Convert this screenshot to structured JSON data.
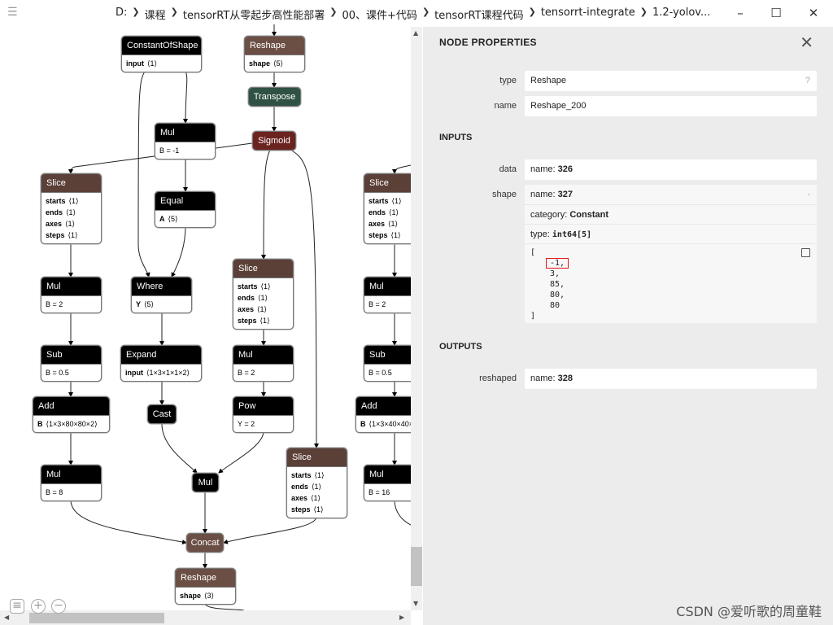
{
  "titlebar": {
    "menu_icon": "hamburger-icon",
    "breadcrumb": [
      "D:",
      "课程",
      "tensorRT从零起步高性能部署",
      "00、课件+代码",
      "tensorRT课程代码",
      "tensorrt-integrate",
      "1.2-yolov..."
    ],
    "minimize": "–",
    "maximize": "☐",
    "close": "✕"
  },
  "colors": {
    "layer": "#000000",
    "shape": "#6b4e44",
    "transform": "#2f5244",
    "activation": "#6b2320",
    "slice": "#5b4038"
  },
  "graph": {
    "nodes": [
      {
        "op": "ConstantOfShape",
        "kind": "layer",
        "attrs": [
          {
            "b": "input",
            "v": "⟨1⟩"
          }
        ]
      },
      {
        "op": "Reshape",
        "kind": "shape",
        "attrs": [
          {
            "b": "shape",
            "v": "⟨5⟩"
          }
        ]
      },
      {
        "op": "Transpose",
        "kind": "transform",
        "attrs": []
      },
      {
        "op": "Mul",
        "kind": "layer",
        "attrs": [
          {
            "b": "",
            "v": "B = -1"
          }
        ]
      },
      {
        "op": "Sigmoid",
        "kind": "activation",
        "attrs": []
      },
      {
        "op": "Slice",
        "kind": "slice",
        "attrs": [
          {
            "b": "starts",
            "v": "⟨1⟩"
          },
          {
            "b": "ends",
            "v": "⟨1⟩"
          },
          {
            "b": "axes",
            "v": "⟨1⟩"
          },
          {
            "b": "steps",
            "v": "⟨1⟩"
          }
        ]
      },
      {
        "op": "Equal",
        "kind": "layer",
        "attrs": [
          {
            "b": "A",
            "v": "⟨5⟩"
          }
        ]
      },
      {
        "op": "Slice",
        "kind": "slice",
        "attrs": [
          {
            "b": "starts",
            "v": "⟨1⟩"
          },
          {
            "b": "ends",
            "v": "⟨1⟩"
          },
          {
            "b": "axes",
            "v": "⟨1⟩"
          },
          {
            "b": "steps",
            "v": "⟨1⟩"
          }
        ]
      },
      {
        "op": "Slice",
        "kind": "slice",
        "attrs": [
          {
            "b": "starts",
            "v": "⟨1⟩"
          },
          {
            "b": "ends",
            "v": "⟨1⟩"
          },
          {
            "b": "axes",
            "v": "⟨1⟩"
          },
          {
            "b": "steps",
            "v": "⟨1⟩"
          }
        ]
      },
      {
        "op": "Mul",
        "kind": "layer",
        "attrs": [
          {
            "b": "",
            "v": "B = 2"
          }
        ]
      },
      {
        "op": "Where",
        "kind": "layer",
        "attrs": [
          {
            "b": "Y",
            "v": "⟨5⟩"
          }
        ]
      },
      {
        "op": "Mul",
        "kind": "layer",
        "attrs": [
          {
            "b": "",
            "v": "B = 2"
          }
        ]
      },
      {
        "op": "Sub",
        "kind": "layer",
        "attrs": [
          {
            "b": "",
            "v": "B = 0.5"
          }
        ]
      },
      {
        "op": "Expand",
        "kind": "layer",
        "attrs": [
          {
            "b": "input",
            "v": "⟨1×3×1×1×2⟩"
          }
        ]
      },
      {
        "op": "Mul",
        "kind": "layer",
        "attrs": [
          {
            "b": "",
            "v": "B = 2"
          }
        ]
      },
      {
        "op": "Sub",
        "kind": "layer",
        "attrs": [
          {
            "b": "",
            "v": "B = 0.5"
          }
        ]
      },
      {
        "op": "Add",
        "kind": "layer",
        "attrs": [
          {
            "b": "B",
            "v": "⟨1×3×80×80×2⟩"
          }
        ]
      },
      {
        "op": "Cast",
        "kind": "layer",
        "attrs": []
      },
      {
        "op": "Pow",
        "kind": "layer",
        "attrs": [
          {
            "b": "",
            "v": "Y = 2"
          }
        ]
      },
      {
        "op": "Add",
        "kind": "layer",
        "attrs": [
          {
            "b": "B",
            "v": "⟨1×3×40×40×2⟩"
          }
        ]
      },
      {
        "op": "Slice",
        "kind": "slice",
        "attrs": [
          {
            "b": "starts",
            "v": "⟨1⟩"
          },
          {
            "b": "ends",
            "v": "⟨1⟩"
          },
          {
            "b": "axes",
            "v": "⟨1⟩"
          },
          {
            "b": "steps",
            "v": "⟨1⟩"
          }
        ]
      },
      {
        "op": "Mul",
        "kind": "layer",
        "attrs": []
      },
      {
        "op": "Mul",
        "kind": "layer",
        "attrs": [
          {
            "b": "",
            "v": "B = 8"
          }
        ]
      },
      {
        "op": "Mul",
        "kind": "layer",
        "attrs": [
          {
            "b": "",
            "v": "B = 16"
          }
        ]
      },
      {
        "op": "Concat",
        "kind": "shape",
        "attrs": []
      },
      {
        "op": "Reshape",
        "kind": "shape",
        "attrs": [
          {
            "b": "shape",
            "v": "⟨3⟩"
          }
        ]
      }
    ],
    "toolbar": {
      "list_icon": "≡",
      "zoom_in": "+",
      "zoom_out": "−"
    }
  },
  "panel": {
    "title": "NODE PROPERTIES",
    "close": "✕",
    "type_label": "type",
    "type_value": "Reshape",
    "type_help": "?",
    "name_label": "name",
    "name_value": "Reshape_200",
    "inputs_title": "INPUTS",
    "data_label": "data",
    "data_name_key": "name: ",
    "data_name": "326",
    "shape_label": "shape",
    "shape_name_key": "name: ",
    "shape_name": "327",
    "shape_collapse": "-",
    "category_key": "category: ",
    "category": "Constant",
    "type_key": "type: ",
    "tensor_type": "int64[5]",
    "tensor_open": "[",
    "tensor_values": [
      "-1,",
      "3,",
      "85,",
      "80,",
      "80"
    ],
    "tensor_close": "]",
    "highlight_color": "#e8141b",
    "outputs_title": "OUTPUTS",
    "reshaped_label": "reshaped",
    "reshaped_name_key": "name: ",
    "reshaped_name": "328"
  },
  "watermark": "CSDN @爱听歌的周童鞋"
}
